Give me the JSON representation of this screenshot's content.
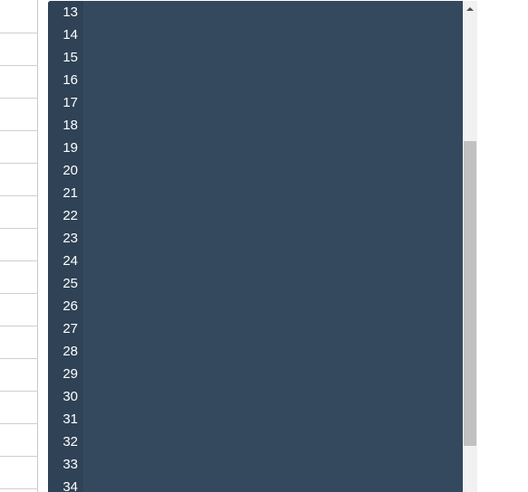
{
  "editor": {
    "line_numbers": [
      "13",
      "14",
      "15",
      "16",
      "17",
      "18",
      "19",
      "20",
      "21",
      "22",
      "23",
      "24",
      "25",
      "26",
      "27",
      "28",
      "29",
      "30",
      "31",
      "32",
      "33",
      "34"
    ]
  },
  "colors": {
    "editor_background": "#34495e",
    "gutter_background": "#2f4256",
    "line_number_text": "#ffffff",
    "scrollbar_track": "#f1f1f1",
    "scrollbar_thumb": "#c1c1c1"
  },
  "icons": {
    "scroll_up": "scroll-up-arrow-icon"
  }
}
